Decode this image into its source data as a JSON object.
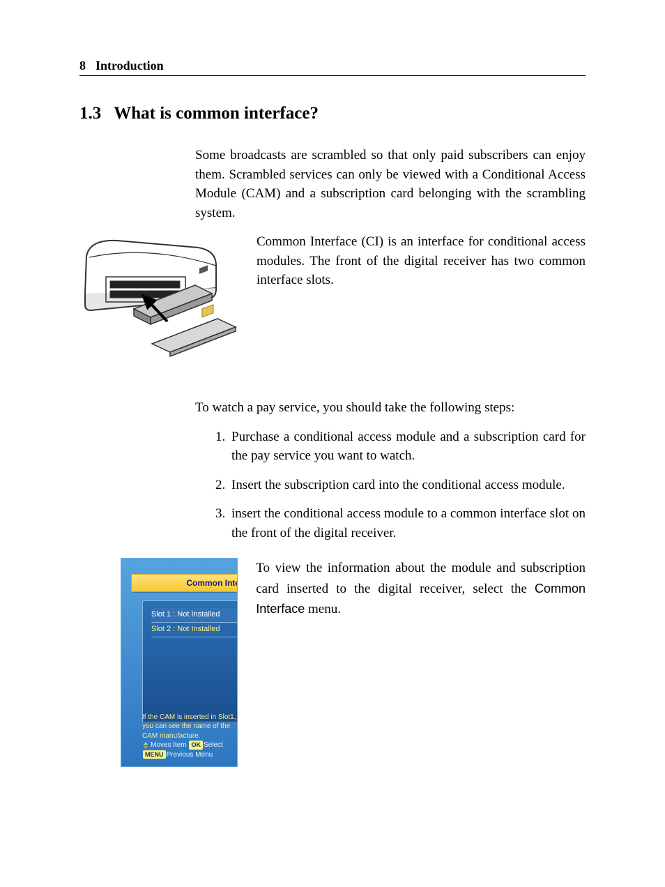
{
  "header": {
    "page_number": "8",
    "chapter_title": "Introduction"
  },
  "section": {
    "number": "1.3",
    "title": "What is common interface?"
  },
  "paragraphs": {
    "p1": "Some broadcasts are scrambled so that only paid subscribers can enjoy them. Scrambled services can only be viewed with a Conditional Access Module (CAM) and a subscription card belonging with the scrambling system.",
    "p2": "Common Interface (CI) is an interface for conditional access modules. The front of the digital receiver has two common interface slots.",
    "p3": "To watch a pay service, you should take the following steps:",
    "p4_prefix": "To view the information about the module and subscription card inserted to the digital receiver, select the ",
    "p4_menu": "Common Interface",
    "p4_suffix": " menu."
  },
  "steps": [
    "Purchase a conditional access module and a subscription card for the pay service you want to watch.",
    "Insert the subscription card into the conditional access module.",
    "insert the conditional access module to a common interface slot on the front of the digital receiver."
  ],
  "screenshot": {
    "title": "Common Interface",
    "slot1": "Slot 1 : Not Installed",
    "slot2": "Slot 2 : Not Installed",
    "hint_line1": "If the CAM is inserted in Slot1,",
    "hint_line2": "you can see the name of the CAM manufacture.",
    "nav_moves": "Moves Item",
    "nav_ok": "OK",
    "nav_select": "Select",
    "nav_menu": "MENU",
    "nav_prev": "Previous Menu"
  }
}
